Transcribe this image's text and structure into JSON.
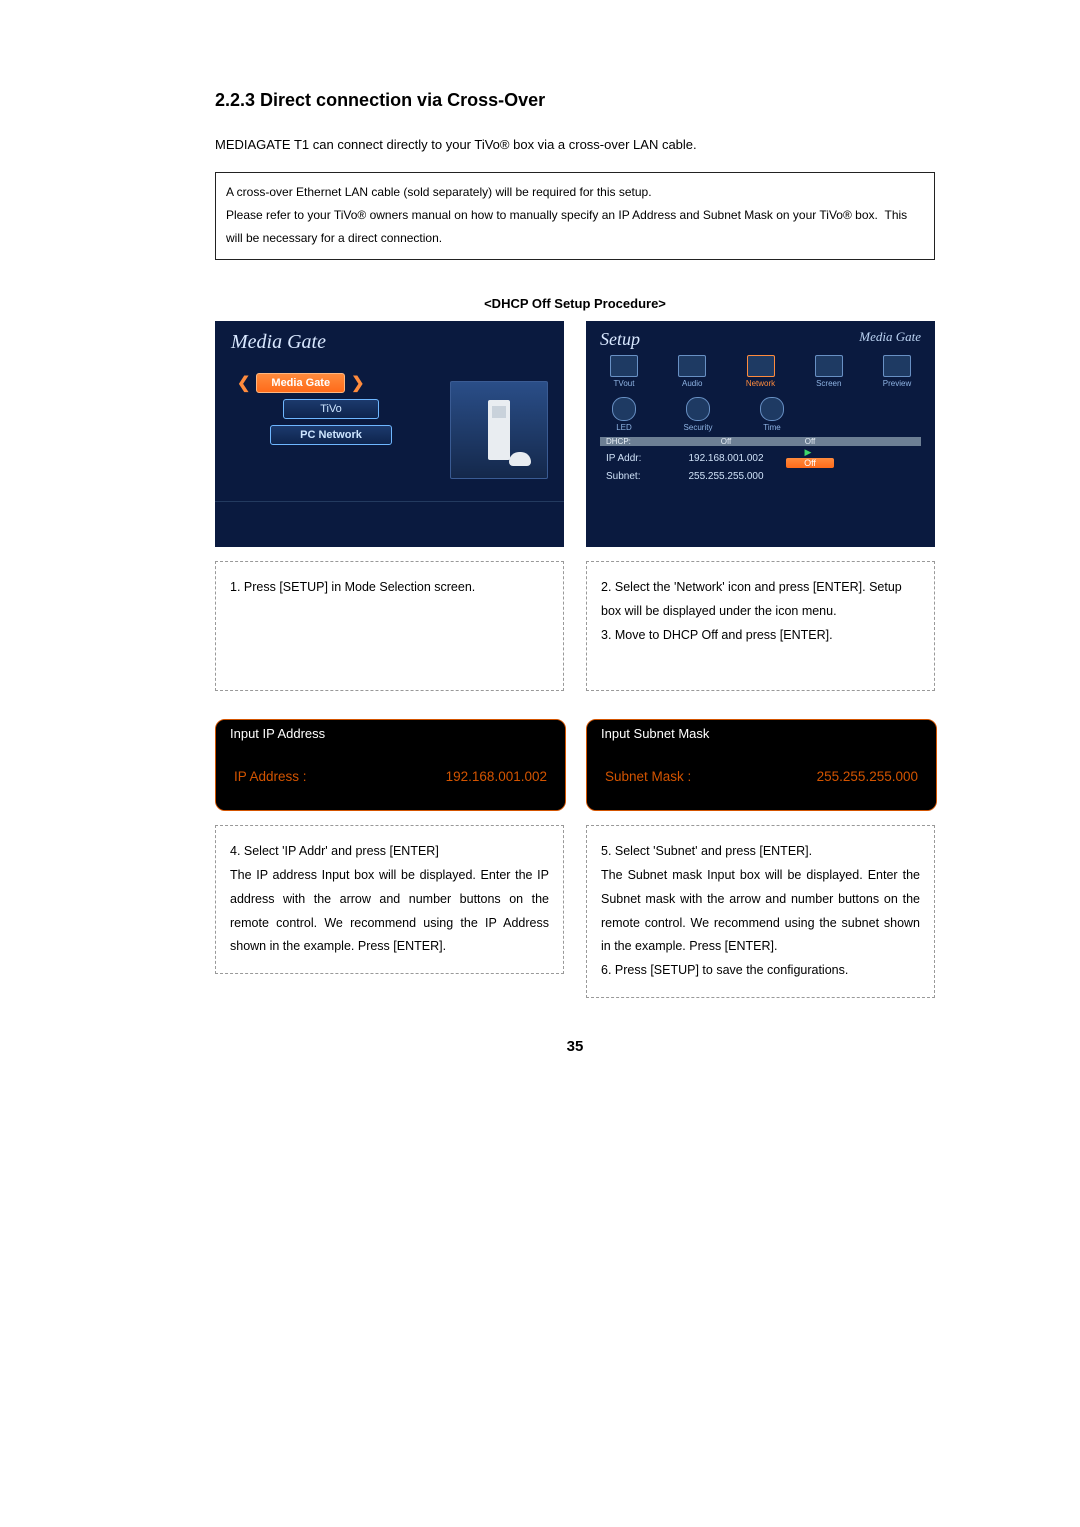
{
  "heading": "2.2.3 Direct connection via Cross-Over",
  "intro": "MEDIAGATE T1 can connect directly to your TiVo® box via a cross-over LAN cable.",
  "note": {
    "line1": "A cross-over Ethernet LAN cable (sold separately) will be required for this setup.",
    "line2a": "Please refer to your TiVo® owners manual on how to manually specify an IP Address and Subnet Mask on your TiVo® box.",
    "line2b": "This will be necessary for a direct connection."
  },
  "subheading": "<DHCP Off Setup Procedure>",
  "shot1": {
    "title": "Media Gate",
    "menu": [
      "Media Gate",
      "TiVo",
      "PC Network"
    ]
  },
  "shot2": {
    "title": "Setup",
    "brand": "Media Gate",
    "icons_row1": [
      "TVout",
      "Audio",
      "Network",
      "Screen",
      "Preview"
    ],
    "icons_row2": [
      "LED",
      "Security",
      "Time"
    ],
    "rows": {
      "dhcp": {
        "label": "DHCP:",
        "value": "Off",
        "off": "Off"
      },
      "ip": {
        "label": "IP Addr:",
        "value": "192.168.001.002",
        "off": "Off"
      },
      "sub": {
        "label": "Subnet:",
        "value": "255.255.255.000"
      }
    }
  },
  "cap1": "1. Press [SETUP] in Mode Selection screen.",
  "cap2": {
    "a": "2. Select the 'Network' icon and press [ENTER]. Setup box will be displayed under the icon menu.",
    "b": "3. Move to DHCP Off and press [ENTER]."
  },
  "ip_box": {
    "title": "Input IP Address",
    "label": "IP Address :",
    "value": "192.168.001.002"
  },
  "subnet_box": {
    "title": "Input Subnet Mask",
    "label": "Subnet Mask :",
    "value": "255.255.255.000"
  },
  "cap4": {
    "a": "4. Select 'IP Addr' and press [ENTER]",
    "b": "The IP address Input box will be displayed. Enter the IP address with the arrow and number buttons on the remote control. We recommend using the IP Address shown in the example. Press [ENTER]."
  },
  "cap5": {
    "a": "5. Select 'Subnet' and press [ENTER].",
    "b": "The Subnet mask Input box will be displayed. Enter the Subnet mask with the arrow and number buttons on the remote control. We recommend using the subnet shown in the example. Press [ENTER].",
    "c": "6. Press [SETUP] to save the configurations."
  },
  "page_number": "35"
}
